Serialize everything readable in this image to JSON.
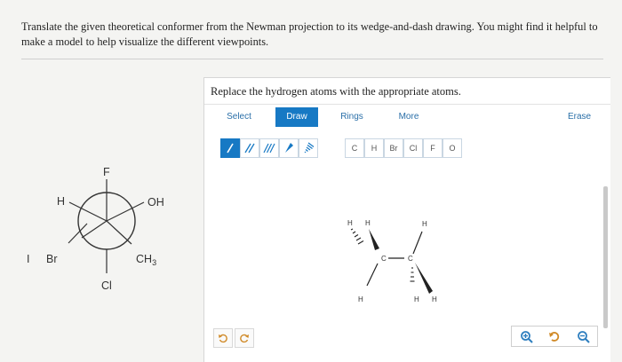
{
  "question": {
    "text": "Translate the given theoretical conformer from the Newman projection to its wedge-and-dash drawing. You might find it helpful to make a model to help visualize the different viewpoints."
  },
  "newman": {
    "front_atoms": [
      "H",
      "OH",
      "CH3"
    ],
    "back_atoms": [
      "F",
      "Br",
      "Cl"
    ],
    "left_mark": "I",
    "labels": {
      "top": "F",
      "upper_left": "H",
      "upper_right": "OH",
      "lower_left": "Br",
      "lower_right_base": "CH",
      "lower_right_sub": "3",
      "bottom": "Cl",
      "far_left": "I"
    }
  },
  "panel": {
    "title": "Replace the hydrogen atoms with the appropriate atoms.",
    "tabs": [
      {
        "label": "Select",
        "active": false
      },
      {
        "label": "Draw",
        "active": true
      },
      {
        "label": "Rings",
        "active": false
      },
      {
        "label": "More",
        "active": false
      },
      {
        "label": "Erase",
        "active": false
      }
    ],
    "bond_tools": [
      "single-bond",
      "double-bond",
      "triple-bond",
      "wedge-bond",
      "dash-bond"
    ],
    "atoms": [
      "C",
      "H",
      "Br",
      "Cl",
      "F",
      "O"
    ],
    "molecule_labels": {
      "h1": "H",
      "h2": "H",
      "c1": "C",
      "c2": "C",
      "h3": "H",
      "h4": "H",
      "h5": "H",
      "h6": "H"
    },
    "colors": {
      "accent": "#1779c4",
      "bond": "#222222",
      "tab_text": "#2a6fa8",
      "zoom_icon": "#2f7fbf",
      "reset_icon": "#d08a28"
    }
  }
}
